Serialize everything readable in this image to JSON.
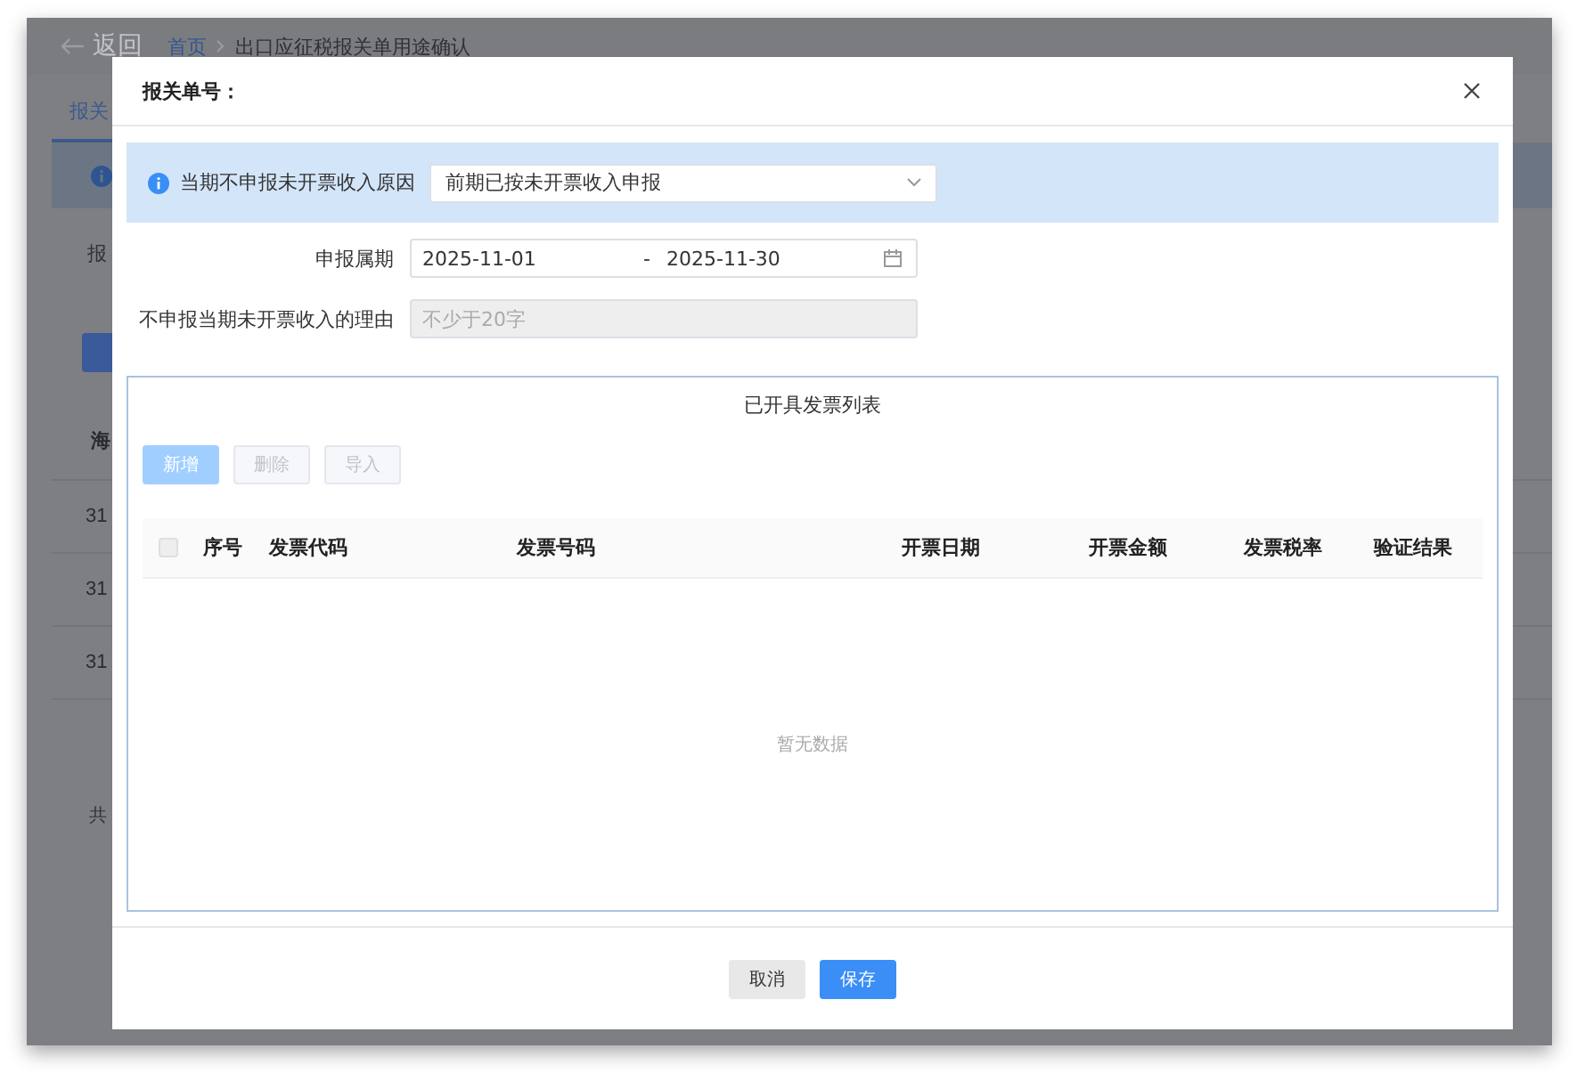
{
  "background_page": {
    "back_link": "返回",
    "breadcrumb": [
      {
        "label": "首页",
        "kind": "link"
      },
      {
        "label": "出口应征税报关单用途确认",
        "kind": "current"
      }
    ],
    "tab": "报关",
    "filter_label": "报",
    "table_header": "海",
    "rows": [
      "31",
      "31",
      "31"
    ],
    "footer_text": "共"
  },
  "dialog": {
    "title": "报关单号：",
    "reason": {
      "label": "当期不申报未开票收入原因",
      "value": "前期已按未开票收入申报"
    },
    "period": {
      "label": "申报属期",
      "start": "2025-11-01",
      "separator": "-",
      "end": "2025-11-30"
    },
    "reason_text": {
      "label": "不申报当期未开票收入的理由",
      "placeholder": "不少于20字",
      "disabled": true
    },
    "invoice_list": {
      "title": "已开具发票列表",
      "buttons": [
        {
          "label": "新增",
          "kind": "primary",
          "disabled": true
        },
        {
          "label": "删除",
          "kind": "default",
          "disabled": true
        },
        {
          "label": "导入",
          "kind": "default",
          "disabled": true
        }
      ],
      "select_all_checked": false,
      "columns": [
        "序号",
        "发票代码",
        "发票号码",
        "开票日期",
        "开票金额",
        "发票税率",
        "验证结果"
      ],
      "empty_text": "暂无数据"
    },
    "footer_buttons": [
      {
        "label": "取消",
        "kind": "default"
      },
      {
        "label": "保存",
        "kind": "primary"
      }
    ]
  }
}
